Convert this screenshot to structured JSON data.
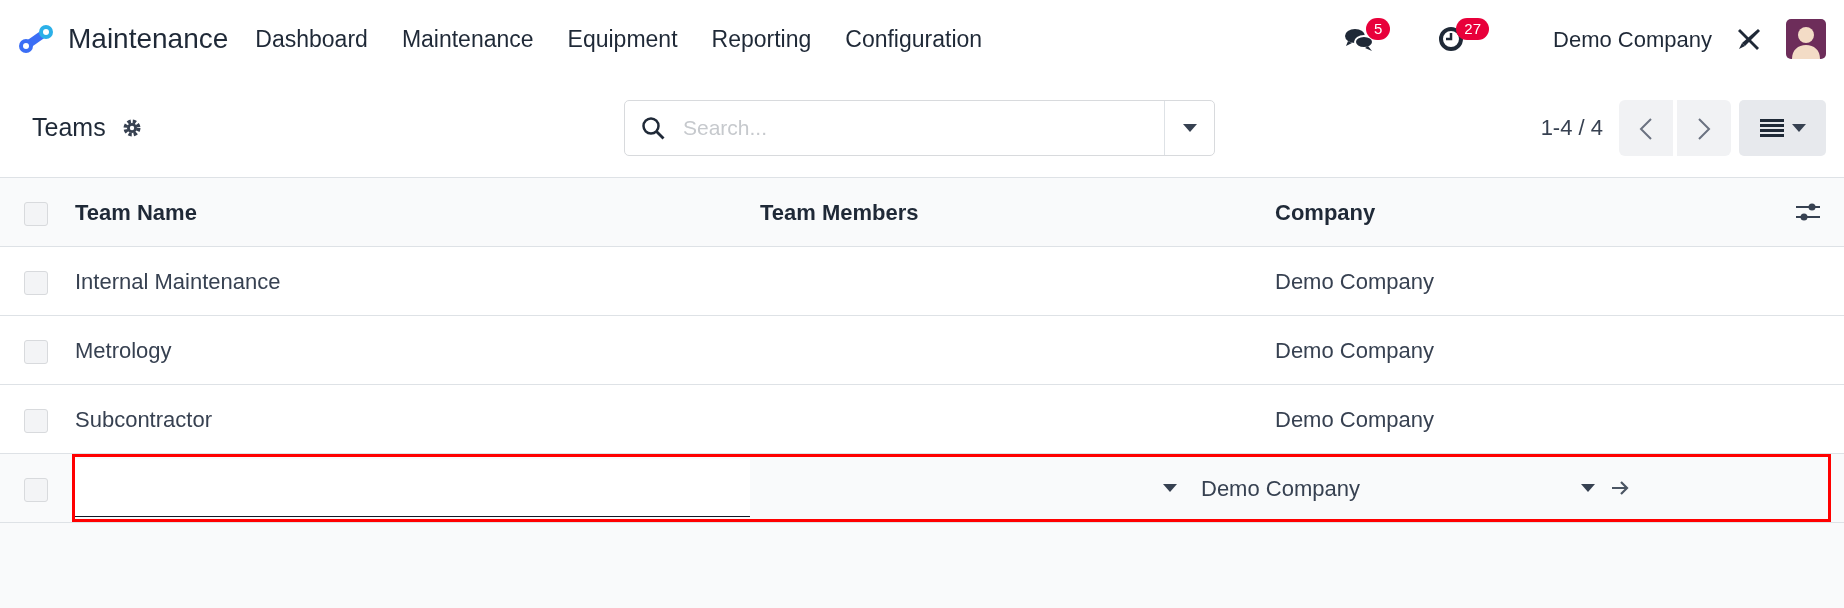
{
  "navbar": {
    "app_name": "Maintenance",
    "menu": [
      "Dashboard",
      "Maintenance",
      "Equipment",
      "Reporting",
      "Configuration"
    ],
    "messages_badge": "5",
    "activities_badge": "27",
    "company": "Demo Company"
  },
  "control_panel": {
    "title": "Teams",
    "search": {
      "placeholder": "Search..."
    },
    "pager": "1-4 / 4"
  },
  "table": {
    "columns": [
      "Team Name",
      "Team Members",
      "Company"
    ],
    "header_checked": false,
    "rows": [
      {
        "team_name": "Internal Maintenance",
        "company": "Demo Company",
        "checked": false
      },
      {
        "team_name": "Metrology",
        "company": "Demo Company",
        "checked": false
      },
      {
        "team_name": "Subcontractor",
        "company": "Demo Company",
        "checked": false
      }
    ],
    "new_row": {
      "company": "Demo Company",
      "checked": false,
      "highlighted": true
    }
  }
}
